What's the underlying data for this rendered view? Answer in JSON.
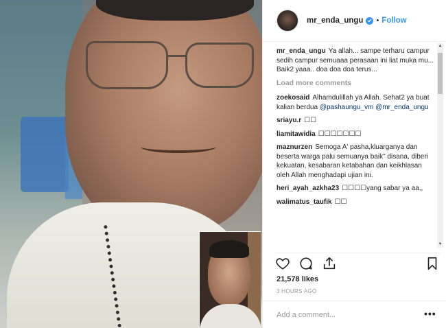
{
  "post": {
    "username": "mr_enda_ungu",
    "separator": "•",
    "follow_label": "Follow",
    "verified_icon": "✔",
    "likes": "21,578 likes",
    "time": "3 HOURS AGO",
    "add_comment_placeholder": "Add a comment...",
    "more_label": "•••",
    "load_more": "Load more comments"
  },
  "caption": {
    "user": "mr_enda_ungu",
    "text": "Ya allah... sampe terharu campur sedih campur semuaaa perasaan ini liat muka mu... Baik2 yaaa.. doa doa doa terus..."
  },
  "comments": [
    {
      "user": "zoekosaid",
      "text": "Alhamdulillah ya Allah. Sehat2 ya buat kalian berdua ",
      "mention1": "@pashaungu_vm",
      "mention2": "@mr_enda_ungu"
    },
    {
      "user": "sriayu.r",
      "text": "☐☐"
    },
    {
      "user": "liamitawidia",
      "text": "☐☐☐☐☐☐☐"
    },
    {
      "user": "maznurzen",
      "text": "Semoga A' pasha,kluarganya dan beserta warga palu semuanya baik\" disana, diberi kekuatan, kesabaran ketabahan dan keikhlasan oleh Allah menghadapi ujian ini."
    },
    {
      "user": "heri_ayah_azkha23",
      "text": "☐☐☐☐yang sabar ya aa,,"
    },
    {
      "user": "walimatus_taufik",
      "text": "☐☐"
    }
  ],
  "colors": {
    "link": "#3897f0",
    "mention": "#003569",
    "muted": "#999999"
  }
}
